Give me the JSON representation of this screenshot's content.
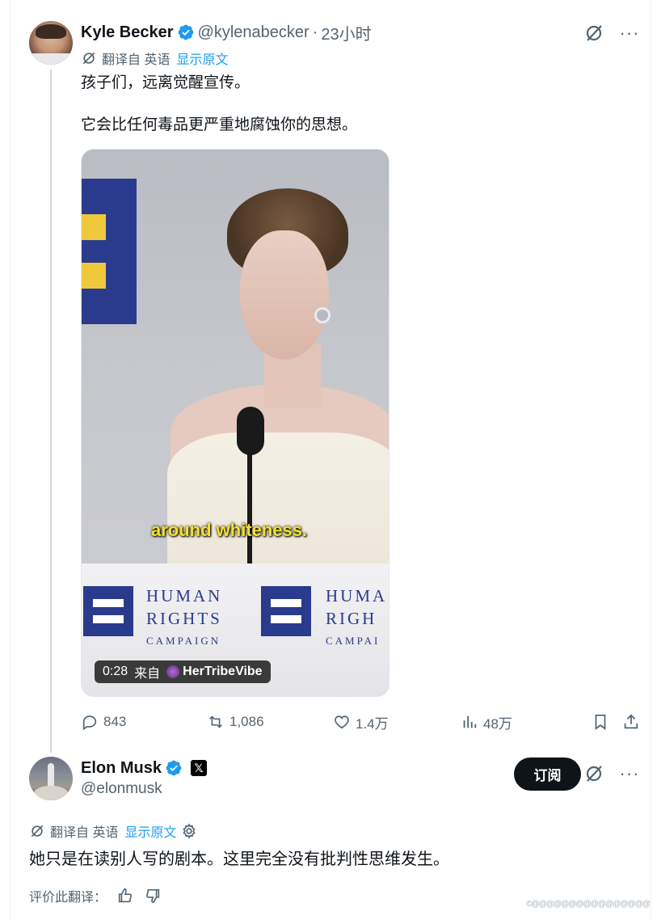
{
  "tweet": {
    "author_name": "Kyle Becker",
    "handle": "@kylenabecker",
    "separator": "·",
    "time": "23小时",
    "translation": {
      "label": "翻译自 英语",
      "show_original": "显示原文"
    },
    "text_line1": "孩子们，远离觉醒宣传。",
    "text_line2": "它会比任何毒品更严重地腐蚀你的思想。",
    "media": {
      "caption": "around whiteness.",
      "duration": "0:28",
      "source_prefix": "来自",
      "source_name": "HerTribeVibe",
      "podium_line1": "HUMAN",
      "podium_line2": "RIGHTS",
      "podium_line3": "CAMPAIGN",
      "podium2_line1": "HUMA",
      "podium2_line2": "RIGH",
      "podium2_line3": "CAMPAI"
    },
    "stats": {
      "replies": "843",
      "reposts": "1,086",
      "likes": "1.4万",
      "views": "48万"
    },
    "icons": [
      "grok-icon",
      "more-icon",
      "translate-icon",
      "reply-icon",
      "repost-icon",
      "like-icon",
      "views-icon",
      "bookmark-icon",
      "share-icon"
    ]
  },
  "reply": {
    "author_name": "Elon Musk",
    "handle": "@elonmusk",
    "badge": "𝕏",
    "subscribe_label": "订阅",
    "translation": {
      "label": "翻译自 英语",
      "show_original": "显示原文"
    },
    "text": "她只是在读别人写的剧本。这里完全没有批判性思维发生。",
    "rate_label": "评价此翻译："
  },
  "watermark": "©@@@@@@@@@@@@@@@@",
  "colors": {
    "accent": "#1d9bf0",
    "text": "#0f1419",
    "secondary": "#536471",
    "hrc_blue": "#2a3a8c",
    "hrc_yellow": "#f0c83c"
  }
}
